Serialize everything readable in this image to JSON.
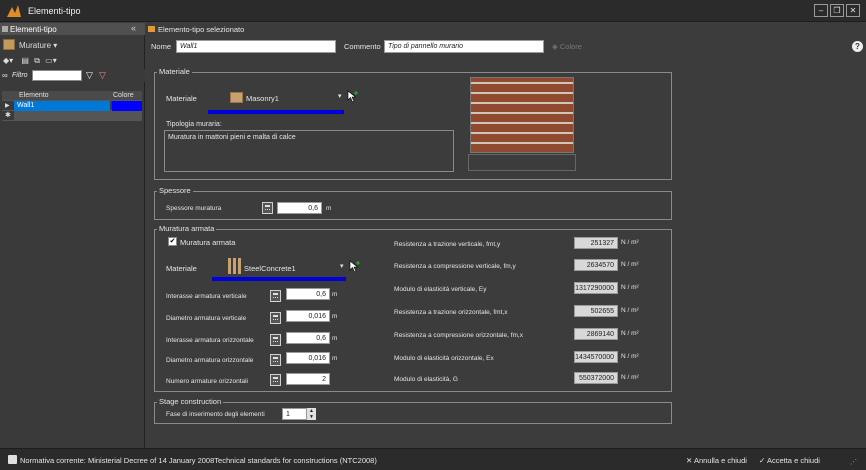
{
  "window": {
    "title": "Elementi-tipo"
  },
  "left_panel": {
    "header": "Elementi-tipo",
    "material_selector": "Murature",
    "filter_label": "Filtro",
    "columns": [
      "Elemento",
      "Colore"
    ],
    "rows": [
      {
        "name": "Wall1",
        "color": "#0000ff"
      }
    ]
  },
  "main": {
    "header": "Elemento-tipo selezionato",
    "name_label": "Nome",
    "name_value": "Wall1",
    "comment_label": "Commento",
    "comment_value": "Tipo di pannello murario",
    "color_button": "Colore",
    "materiale": {
      "group_title": "Materiale",
      "material_label": "Materiale",
      "material_value": "Masonry1",
      "tipologia_label": "Tipologia muraria:",
      "tipologia_value": "Muratura in mattoni pieni e malta di calce"
    },
    "spessore": {
      "group_title": "Spessore",
      "label": "Spessore muratura",
      "value": "0,6",
      "unit": "m"
    },
    "armata": {
      "group_title": "Muratura armata",
      "checkbox_label": "Muratura armata",
      "checked": true,
      "material_label": "Materiale",
      "material_value": "SteelConcrete1",
      "left_fields": [
        {
          "label": "Interasse armatura verticale",
          "value": "0,6",
          "unit": "m"
        },
        {
          "label": "Diametro armatura verticale",
          "value": "0,016",
          "unit": "m"
        },
        {
          "label": "Interasse armatura orizzontale",
          "value": "0,6",
          "unit": "m"
        },
        {
          "label": "Diametro armatura orizzontale",
          "value": "0,016",
          "unit": "m"
        },
        {
          "label": "Numero armature orizzontali",
          "value": "2",
          "unit": ""
        }
      ],
      "right_fields": [
        {
          "label": "Resistenza a trazione verticale, fmt,y",
          "value": "251327",
          "unit": "N / m²"
        },
        {
          "label": "Resistenza a compressione verticale, fm,y",
          "value": "2634570",
          "unit": "N / m²"
        },
        {
          "label": "Modulo di elasticità verticale, Ey",
          "value": "1317290000",
          "unit": "N / m²"
        },
        {
          "label": "Resistenza a trazione orizzontale, fmt,x",
          "value": "502655",
          "unit": "N / m²"
        },
        {
          "label": "Resistenza a compressione orizzontale, fm,x",
          "value": "2869140",
          "unit": "N / m²"
        },
        {
          "label": "Modulo di elasticità orizzontale, Ex",
          "value": "1434570000",
          "unit": "N / m²"
        },
        {
          "label": "Modulo di elasticità, G",
          "value": "550372000",
          "unit": "N / m²"
        }
      ]
    },
    "stage": {
      "group_title": "Stage construction",
      "label": "Fase di inserimento degli elementi",
      "value": "1"
    }
  },
  "status": {
    "normativa_label": "Normativa corrente:",
    "normativa_value": "Ministerial Decree of 14 January 2008Technical standards for constructions (NTC2008)",
    "cancel": "Annulla e chiudi",
    "accept": "Accetta e chiudi"
  },
  "colors": {
    "accent_blue": "#0000d8",
    "selection": "#0078d7",
    "brick": "#8f4a30"
  },
  "icons": [
    "app-logo-icon",
    "minimize-icon",
    "restore-icon",
    "close-icon",
    "collapse-icon",
    "help-icon",
    "calculator-icon",
    "pick-cursor-icon",
    "masonry-material-icon",
    "steel-concrete-icon",
    "filter-icon",
    "bucket-icon",
    "x-icon",
    "check-icon"
  ]
}
